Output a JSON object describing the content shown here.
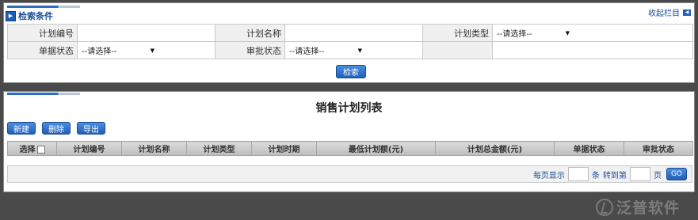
{
  "search_panel": {
    "title": "检索条件",
    "collapse_label": "收起栏目",
    "fields": {
      "plan_no_label": "计划编号",
      "plan_name_label": "计划名称",
      "plan_type_label": "计划类型",
      "doc_status_label": "单据状态",
      "approve_status_label": "审批状态"
    },
    "select_placeholder": "--请选择--",
    "search_button": "检索"
  },
  "list_panel": {
    "title": "销售计划列表",
    "toolbar": {
      "new": "新建",
      "delete": "删除",
      "export": "导出"
    },
    "columns": [
      "选择",
      "计划编号",
      "计划名称",
      "计划类型",
      "计划时期",
      "最低计划额(元)",
      "计划总金额(元)",
      "单据状态",
      "审批状态"
    ],
    "pager": {
      "per_page": "每页显示",
      "unit": "条",
      "goto": "转到第",
      "page": "页",
      "go": "GO"
    }
  },
  "logo": {
    "text": "泛普软件"
  }
}
